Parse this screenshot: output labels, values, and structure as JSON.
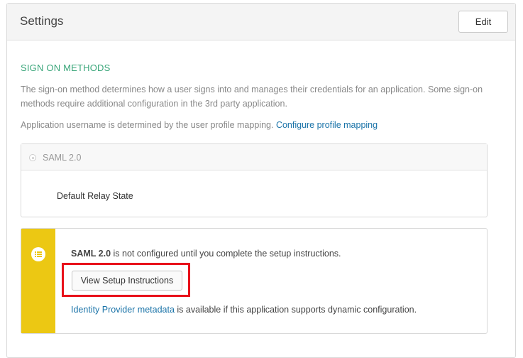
{
  "panel": {
    "title": "Settings",
    "edit_label": "Edit"
  },
  "sign_on": {
    "section_title": "SIGN ON METHODS",
    "description": "The sign-on method determines how a user signs into and manages their credentials for an application. Some sign-on methods require additional configuration in the 3rd party application.",
    "username_text": "Application username is determined by the user profile mapping.",
    "username_link": "Configure profile mapping",
    "method": {
      "label": "SAML 2.0",
      "relay_state_label": "Default Relay State"
    }
  },
  "notice": {
    "protocol": "SAML 2.0",
    "message": " is not configured until you complete the setup instructions.",
    "button_label": "View Setup Instructions",
    "metadata_link": "Identity Provider metadata",
    "metadata_text": " is available if this application supports dynamic configuration.",
    "icon": "list-icon",
    "stripe_color": "#ecc813",
    "highlight_color": "#e8111a"
  }
}
